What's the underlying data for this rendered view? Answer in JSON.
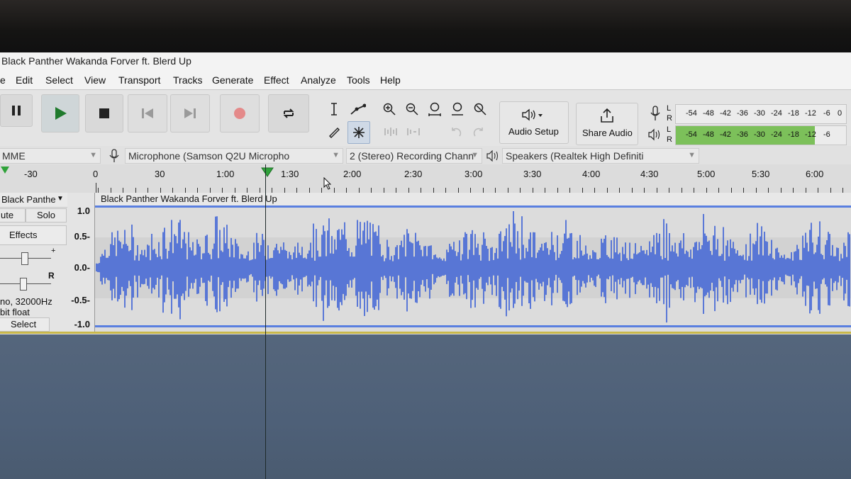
{
  "window": {
    "title": "Black Panther Wakanda Forver ft. Blerd Up"
  },
  "menu": [
    "Edit",
    "Select",
    "View",
    "Transport",
    "Tracks",
    "Generate",
    "Effect",
    "Analyze",
    "Tools",
    "Help"
  ],
  "toolbar": {
    "audio_setup_label": "Audio Setup",
    "share_audio_label": "Share Audio",
    "icons": [
      "pause-icon",
      "play-icon",
      "stop-icon",
      "skip-start-icon",
      "skip-end-icon",
      "record-icon",
      "loop-icon",
      "select-tool-icon",
      "envelope-tool-icon",
      "draw-tool-icon",
      "multi-tool-icon",
      "zoom-in-icon",
      "zoom-out-icon",
      "fit-selection-icon",
      "fit-project-icon",
      "zoom-toggle-icon",
      "trim-icon",
      "silence-icon",
      "undo-icon",
      "redo-icon",
      "speaker-icon",
      "share-icon",
      "microphone-icon"
    ]
  },
  "meters": {
    "record_scale": [
      "-54",
      "-48",
      "-42",
      "-36",
      "-30",
      "-24",
      "-18",
      "-12",
      "-6",
      "0"
    ],
    "play_scale": [
      "-54",
      "-48",
      "-42",
      "-36",
      "-30",
      "-24",
      "-18",
      "-12",
      "-6"
    ],
    "channels": [
      "L",
      "R"
    ],
    "play_level_color": "#7cc05a"
  },
  "devices": {
    "host": "MME",
    "microphone": "Microphone (Samson Q2U Micropho",
    "channels": "2 (Stereo) Recording Chann",
    "speakers": "Speakers (Realtek High Definiti"
  },
  "timeline": {
    "labels": [
      "-30",
      "0",
      "30",
      "1:00",
      "1:30",
      "2:00",
      "2:30",
      "3:00",
      "3:30",
      "4:00",
      "4:30",
      "5:00",
      "5:30",
      "6:00"
    ]
  },
  "track": {
    "name": "Black Panthe",
    "mute_label": "ute",
    "solo_label": "Solo",
    "effects_label": "Effects",
    "pan_right_label": "R",
    "gain_plus_label": "+",
    "format_line1": "no, 32000Hz",
    "format_line2": "bit float",
    "select_label": "Select",
    "clip_name": "Black Panther Wakanda Forver ft. Blerd Up",
    "scale": [
      "1.0",
      "0.5-",
      "0.0-",
      "-0.5-",
      "-1.0"
    ],
    "waveform_color": "#3a5fd6"
  }
}
